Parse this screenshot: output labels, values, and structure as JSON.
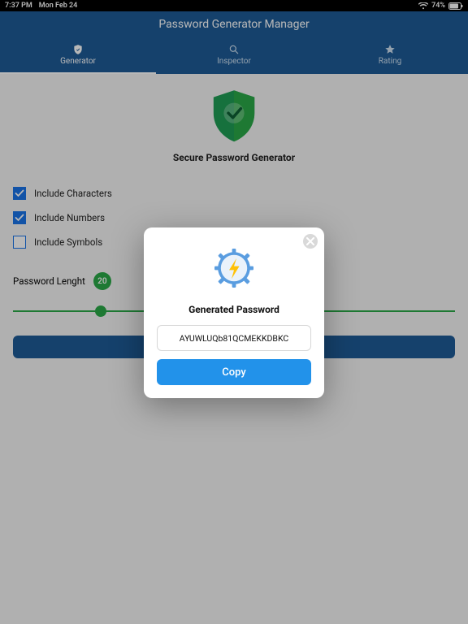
{
  "status": {
    "time": "7:37 PM",
    "date": "Mon Feb 24"
  },
  "header": {
    "title": "Password Generator Manager",
    "tabs": [
      {
        "label": "Generator"
      },
      {
        "label": "Inspector"
      },
      {
        "label": "Rating"
      }
    ]
  },
  "main": {
    "subtitle": "Secure Password Generator",
    "options": {
      "chars_label": "Include Characters",
      "numbers_label": "Include Numbers",
      "symbols_label": "Include Symbols"
    },
    "length_label": "Password Lenght",
    "length_value": "20"
  },
  "modal": {
    "title": "Generated Password",
    "password": "AYUWLUQb81QCMEKKDBKC",
    "copy_label": "Copy"
  }
}
